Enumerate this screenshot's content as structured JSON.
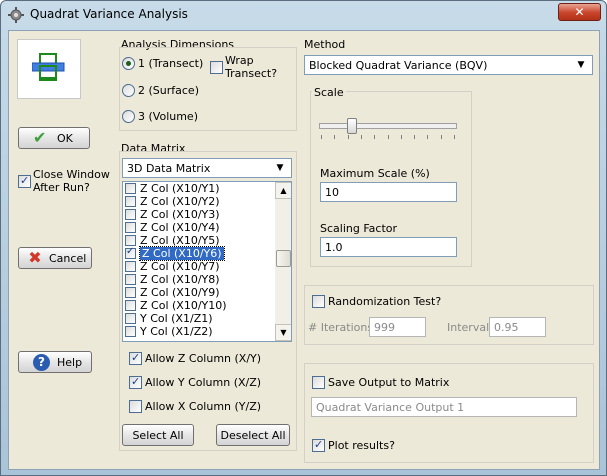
{
  "window": {
    "title": "Quadrat Variance Analysis",
    "close_label": "✕"
  },
  "left": {
    "ok_label": "OK",
    "close_after_run_label": "Close Window After Run?",
    "close_after_run_checked": true,
    "cancel_label": "Cancel",
    "help_label": "Help"
  },
  "analysis_dimensions": {
    "title": "Analysis Dimensions",
    "options": [
      "1 (Transect)",
      "2 (Surface)",
      "3 (Volume)"
    ],
    "selected_index": 0,
    "wrap_label": "Wrap Transect?"
  },
  "data_matrix": {
    "title": "Data Matrix",
    "combo_value": "3D Data Matrix",
    "items": [
      {
        "label": "Z Col (X10/Y1)",
        "checked": false
      },
      {
        "label": "Z Col (X10/Y2)",
        "checked": false
      },
      {
        "label": "Z Col (X10/Y3)",
        "checked": false
      },
      {
        "label": "Z Col (X10/Y4)",
        "checked": false
      },
      {
        "label": "Z Col (X10/Y5)",
        "checked": false
      },
      {
        "label": "Z Col (X10/Y6)",
        "checked": true,
        "selected": true
      },
      {
        "label": "Z Col (X10/Y7)",
        "checked": false
      },
      {
        "label": "Z Col (X10/Y8)",
        "checked": false
      },
      {
        "label": "Z Col (X10/Y9)",
        "checked": false
      },
      {
        "label": "Z Col (X10/Y10)",
        "checked": false
      },
      {
        "label": "Y Col (X1/Z1)",
        "checked": false
      },
      {
        "label": "Y Col (X1/Z2)",
        "checked": false
      }
    ],
    "allow_z_label": "Allow Z Column (X/Y)",
    "allow_y_label": "Allow Y Column (X/Z)",
    "allow_x_label": "Allow X Column (Y/Z)",
    "allow_z_checked": true,
    "allow_y_checked": true,
    "allow_x_checked": false,
    "select_all_label": "Select All",
    "deselect_all_label": "Deselect All"
  },
  "method": {
    "title": "Method",
    "value": "Blocked Quadrat Variance (BQV)"
  },
  "scale": {
    "title": "Scale",
    "slider_fraction": 0.22,
    "max_scale_label": "Maximum Scale (%)",
    "max_scale_value": "10",
    "scaling_factor_label": "Scaling Factor",
    "scaling_factor_value": "1.0"
  },
  "randomization": {
    "label": "Randomization Test?",
    "checked": false,
    "iterations_label": "# Iterations",
    "iterations_value": "999",
    "interval_label": "Interval",
    "interval_value": "0.95"
  },
  "output": {
    "save_label": "Save Output to Matrix",
    "save_checked": false,
    "name_value": "Quadrat Variance Output 1",
    "plot_label": "Plot results?",
    "plot_checked": true
  },
  "colors": {
    "accent": "#316ac5",
    "ok_green": "#3aa13a",
    "cancel_red": "#d03a2a",
    "help_blue": "#2a5db0"
  }
}
